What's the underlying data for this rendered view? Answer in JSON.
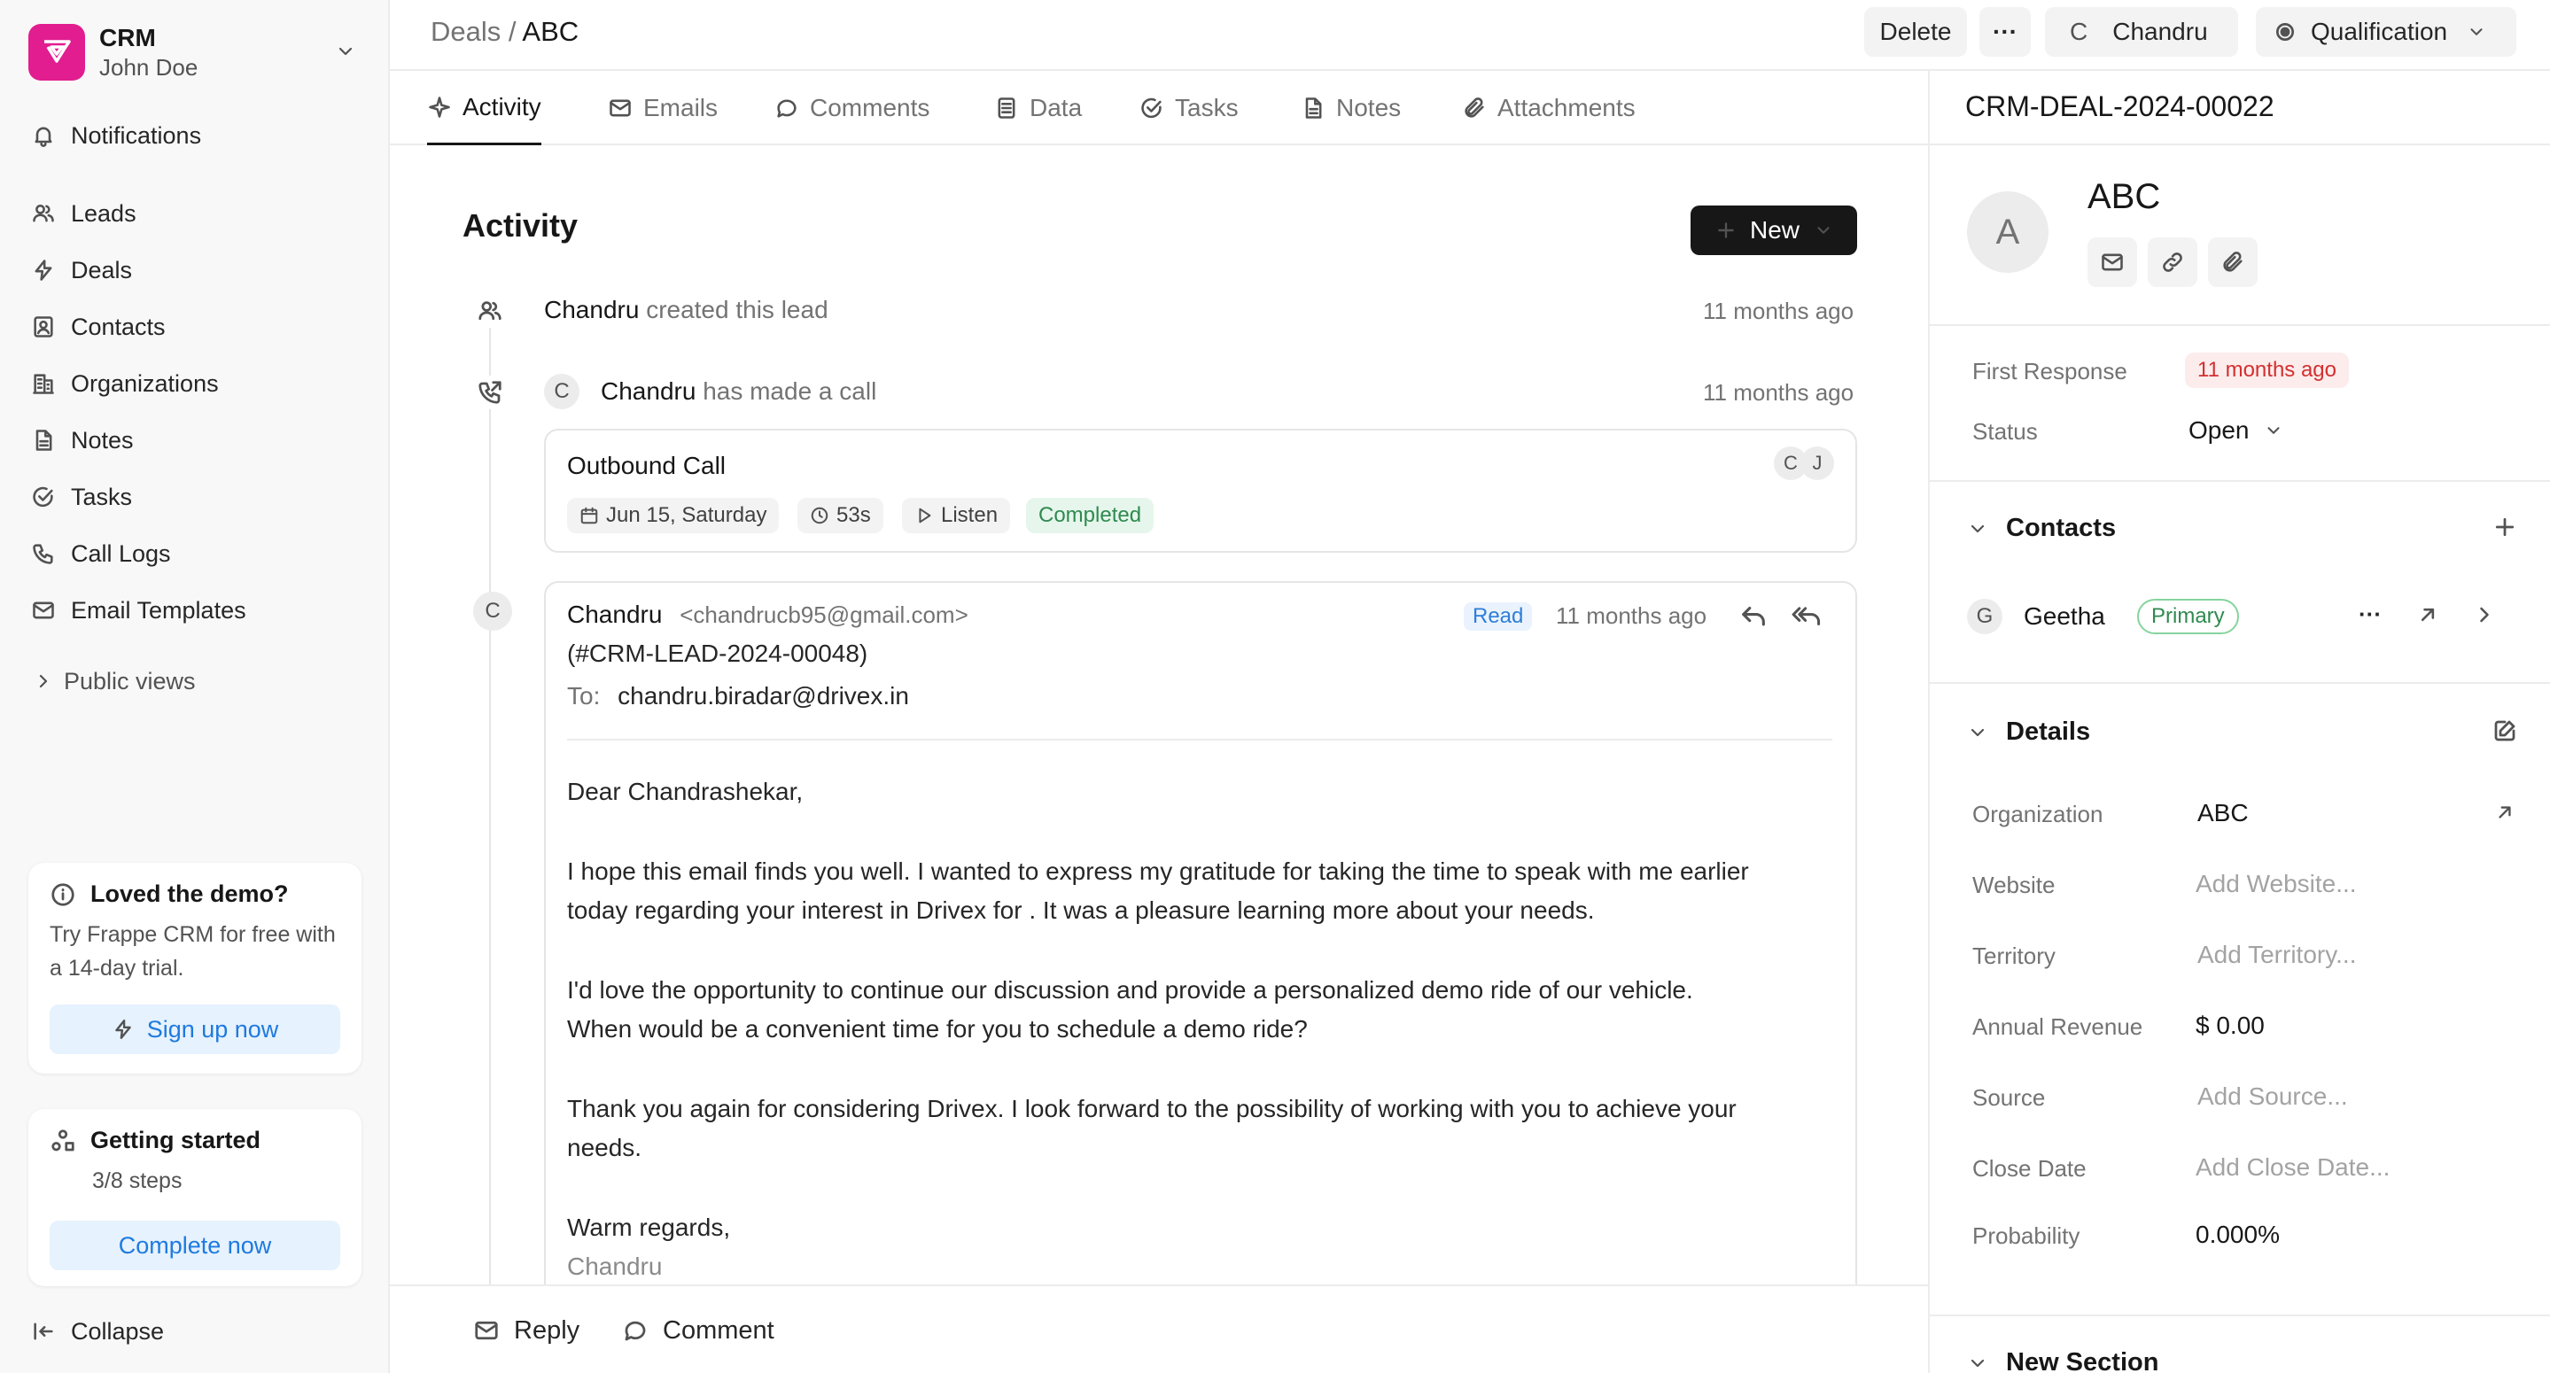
{
  "sidebar": {
    "brand": {
      "name": "CRM",
      "user": "John Doe"
    },
    "items": [
      {
        "label": "Notifications",
        "icon": "bell-icon"
      },
      {
        "label": "Leads",
        "icon": "users-icon"
      },
      {
        "label": "Deals",
        "icon": "lightning-icon"
      },
      {
        "label": "Contacts",
        "icon": "contact-icon"
      },
      {
        "label": "Organizations",
        "icon": "building-icon"
      },
      {
        "label": "Notes",
        "icon": "note-icon"
      },
      {
        "label": "Tasks",
        "icon": "check-circle-icon"
      },
      {
        "label": "Call Logs",
        "icon": "phone-icon"
      },
      {
        "label": "Email Templates",
        "icon": "mail-icon"
      }
    ],
    "public_views": "Public views",
    "demo_card": {
      "title": "Loved the demo?",
      "text": "Try Frappe CRM for free with a 14-day trial.",
      "button": "Sign up now"
    },
    "getting_started": {
      "title": "Getting started",
      "steps": "3/8 steps",
      "button": "Complete now"
    },
    "collapse": "Collapse"
  },
  "header": {
    "breadcrumb_parent": "Deals",
    "breadcrumb_sep": "/",
    "breadcrumb_current": "ABC",
    "delete": "Delete",
    "more": "···",
    "assignee_initial": "C",
    "assignee": "Chandru",
    "status": "Qualification"
  },
  "tabs": [
    {
      "label": "Activity",
      "icon": "activity-icon"
    },
    {
      "label": "Emails",
      "icon": "mail-icon"
    },
    {
      "label": "Comments",
      "icon": "comment-icon"
    },
    {
      "label": "Data",
      "icon": "data-icon"
    },
    {
      "label": "Tasks",
      "icon": "check-circle-icon"
    },
    {
      "label": "Notes",
      "icon": "note-icon"
    },
    {
      "label": "Attachments",
      "icon": "paperclip-icon"
    }
  ],
  "activity": {
    "title": "Activity",
    "new_button": "New",
    "item1": {
      "actor": "Chandru",
      "text": "created this lead",
      "time": "11 months ago"
    },
    "item2": {
      "avatar": "C",
      "actor": "Chandru",
      "text": "has made a call",
      "time": "11 months ago"
    },
    "call": {
      "title": "Outbound Call",
      "date": "Jun 15, Saturday",
      "duration": "53s",
      "listen": "Listen",
      "status": "Completed",
      "avatars": [
        "C",
        "J"
      ]
    },
    "email": {
      "avatar": "C",
      "sender": "Chandru",
      "sender_email": "<chandrucb95@gmail.com>",
      "read": "Read",
      "time": "11 months ago",
      "subject": "(#CRM-LEAD-2024-00048)",
      "to_label": "To:",
      "to": "chandru.biradar@drivex.in",
      "body": [
        "Dear Chandrashekar,",
        "I hope this email finds you well. I wanted to express my gratitude for taking the time to speak with me earlier",
        "today regarding your interest in Drivex for . It was a pleasure learning more about your needs.",
        "I'd love the opportunity to continue our discussion and provide a personalized demo ride of our vehicle.",
        "When would be a convenient time for you to schedule a demo ride?",
        "Thank you again for considering Drivex. I look forward to the possibility of working with you to achieve your",
        "needs.",
        "Warm regards,",
        "Chandru"
      ]
    }
  },
  "footer": {
    "reply": "Reply",
    "comment": "Comment"
  },
  "panel": {
    "deal_id": "CRM-DEAL-2024-00022",
    "avatar": "A",
    "org_name": "ABC",
    "first_response_label": "First Response",
    "first_response": "11 months ago",
    "status_label": "Status",
    "status": "Open",
    "contacts_title": "Contacts",
    "contact": {
      "initial": "G",
      "name": "Geetha",
      "badge": "Primary"
    },
    "details_title": "Details",
    "fields": [
      {
        "label": "Organization",
        "value": "ABC"
      },
      {
        "label": "Website",
        "value": "Add Website..."
      },
      {
        "label": "Territory",
        "value": "Add Territory..."
      },
      {
        "label": "Annual Revenue",
        "value": "$ 0.00"
      },
      {
        "label": "Source",
        "value": "Add Source..."
      },
      {
        "label": "Close Date",
        "value": "Add Close Date..."
      },
      {
        "label": "Probability",
        "value": "0.000%"
      }
    ],
    "new_section": "New Section"
  }
}
